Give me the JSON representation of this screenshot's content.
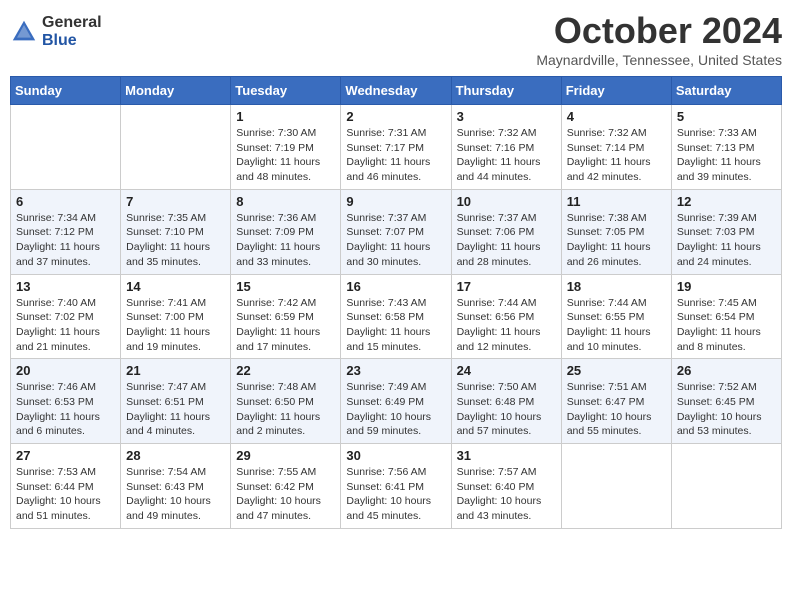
{
  "header": {
    "logo_general": "General",
    "logo_blue": "Blue",
    "month_title": "October 2024",
    "location": "Maynardville, Tennessee, United States"
  },
  "days_of_week": [
    "Sunday",
    "Monday",
    "Tuesday",
    "Wednesday",
    "Thursday",
    "Friday",
    "Saturday"
  ],
  "weeks": [
    [
      {
        "num": "",
        "sunrise": "",
        "sunset": "",
        "daylight": ""
      },
      {
        "num": "",
        "sunrise": "",
        "sunset": "",
        "daylight": ""
      },
      {
        "num": "1",
        "sunrise": "Sunrise: 7:30 AM",
        "sunset": "Sunset: 7:19 PM",
        "daylight": "Daylight: 11 hours and 48 minutes."
      },
      {
        "num": "2",
        "sunrise": "Sunrise: 7:31 AM",
        "sunset": "Sunset: 7:17 PM",
        "daylight": "Daylight: 11 hours and 46 minutes."
      },
      {
        "num": "3",
        "sunrise": "Sunrise: 7:32 AM",
        "sunset": "Sunset: 7:16 PM",
        "daylight": "Daylight: 11 hours and 44 minutes."
      },
      {
        "num": "4",
        "sunrise": "Sunrise: 7:32 AM",
        "sunset": "Sunset: 7:14 PM",
        "daylight": "Daylight: 11 hours and 42 minutes."
      },
      {
        "num": "5",
        "sunrise": "Sunrise: 7:33 AM",
        "sunset": "Sunset: 7:13 PM",
        "daylight": "Daylight: 11 hours and 39 minutes."
      }
    ],
    [
      {
        "num": "6",
        "sunrise": "Sunrise: 7:34 AM",
        "sunset": "Sunset: 7:12 PM",
        "daylight": "Daylight: 11 hours and 37 minutes."
      },
      {
        "num": "7",
        "sunrise": "Sunrise: 7:35 AM",
        "sunset": "Sunset: 7:10 PM",
        "daylight": "Daylight: 11 hours and 35 minutes."
      },
      {
        "num": "8",
        "sunrise": "Sunrise: 7:36 AM",
        "sunset": "Sunset: 7:09 PM",
        "daylight": "Daylight: 11 hours and 33 minutes."
      },
      {
        "num": "9",
        "sunrise": "Sunrise: 7:37 AM",
        "sunset": "Sunset: 7:07 PM",
        "daylight": "Daylight: 11 hours and 30 minutes."
      },
      {
        "num": "10",
        "sunrise": "Sunrise: 7:37 AM",
        "sunset": "Sunset: 7:06 PM",
        "daylight": "Daylight: 11 hours and 28 minutes."
      },
      {
        "num": "11",
        "sunrise": "Sunrise: 7:38 AM",
        "sunset": "Sunset: 7:05 PM",
        "daylight": "Daylight: 11 hours and 26 minutes."
      },
      {
        "num": "12",
        "sunrise": "Sunrise: 7:39 AM",
        "sunset": "Sunset: 7:03 PM",
        "daylight": "Daylight: 11 hours and 24 minutes."
      }
    ],
    [
      {
        "num": "13",
        "sunrise": "Sunrise: 7:40 AM",
        "sunset": "Sunset: 7:02 PM",
        "daylight": "Daylight: 11 hours and 21 minutes."
      },
      {
        "num": "14",
        "sunrise": "Sunrise: 7:41 AM",
        "sunset": "Sunset: 7:00 PM",
        "daylight": "Daylight: 11 hours and 19 minutes."
      },
      {
        "num": "15",
        "sunrise": "Sunrise: 7:42 AM",
        "sunset": "Sunset: 6:59 PM",
        "daylight": "Daylight: 11 hours and 17 minutes."
      },
      {
        "num": "16",
        "sunrise": "Sunrise: 7:43 AM",
        "sunset": "Sunset: 6:58 PM",
        "daylight": "Daylight: 11 hours and 15 minutes."
      },
      {
        "num": "17",
        "sunrise": "Sunrise: 7:44 AM",
        "sunset": "Sunset: 6:56 PM",
        "daylight": "Daylight: 11 hours and 12 minutes."
      },
      {
        "num": "18",
        "sunrise": "Sunrise: 7:44 AM",
        "sunset": "Sunset: 6:55 PM",
        "daylight": "Daylight: 11 hours and 10 minutes."
      },
      {
        "num": "19",
        "sunrise": "Sunrise: 7:45 AM",
        "sunset": "Sunset: 6:54 PM",
        "daylight": "Daylight: 11 hours and 8 minutes."
      }
    ],
    [
      {
        "num": "20",
        "sunrise": "Sunrise: 7:46 AM",
        "sunset": "Sunset: 6:53 PM",
        "daylight": "Daylight: 11 hours and 6 minutes."
      },
      {
        "num": "21",
        "sunrise": "Sunrise: 7:47 AM",
        "sunset": "Sunset: 6:51 PM",
        "daylight": "Daylight: 11 hours and 4 minutes."
      },
      {
        "num": "22",
        "sunrise": "Sunrise: 7:48 AM",
        "sunset": "Sunset: 6:50 PM",
        "daylight": "Daylight: 11 hours and 2 minutes."
      },
      {
        "num": "23",
        "sunrise": "Sunrise: 7:49 AM",
        "sunset": "Sunset: 6:49 PM",
        "daylight": "Daylight: 10 hours and 59 minutes."
      },
      {
        "num": "24",
        "sunrise": "Sunrise: 7:50 AM",
        "sunset": "Sunset: 6:48 PM",
        "daylight": "Daylight: 10 hours and 57 minutes."
      },
      {
        "num": "25",
        "sunrise": "Sunrise: 7:51 AM",
        "sunset": "Sunset: 6:47 PM",
        "daylight": "Daylight: 10 hours and 55 minutes."
      },
      {
        "num": "26",
        "sunrise": "Sunrise: 7:52 AM",
        "sunset": "Sunset: 6:45 PM",
        "daylight": "Daylight: 10 hours and 53 minutes."
      }
    ],
    [
      {
        "num": "27",
        "sunrise": "Sunrise: 7:53 AM",
        "sunset": "Sunset: 6:44 PM",
        "daylight": "Daylight: 10 hours and 51 minutes."
      },
      {
        "num": "28",
        "sunrise": "Sunrise: 7:54 AM",
        "sunset": "Sunset: 6:43 PM",
        "daylight": "Daylight: 10 hours and 49 minutes."
      },
      {
        "num": "29",
        "sunrise": "Sunrise: 7:55 AM",
        "sunset": "Sunset: 6:42 PM",
        "daylight": "Daylight: 10 hours and 47 minutes."
      },
      {
        "num": "30",
        "sunrise": "Sunrise: 7:56 AM",
        "sunset": "Sunset: 6:41 PM",
        "daylight": "Daylight: 10 hours and 45 minutes."
      },
      {
        "num": "31",
        "sunrise": "Sunrise: 7:57 AM",
        "sunset": "Sunset: 6:40 PM",
        "daylight": "Daylight: 10 hours and 43 minutes."
      },
      {
        "num": "",
        "sunrise": "",
        "sunset": "",
        "daylight": ""
      },
      {
        "num": "",
        "sunrise": "",
        "sunset": "",
        "daylight": ""
      }
    ]
  ]
}
